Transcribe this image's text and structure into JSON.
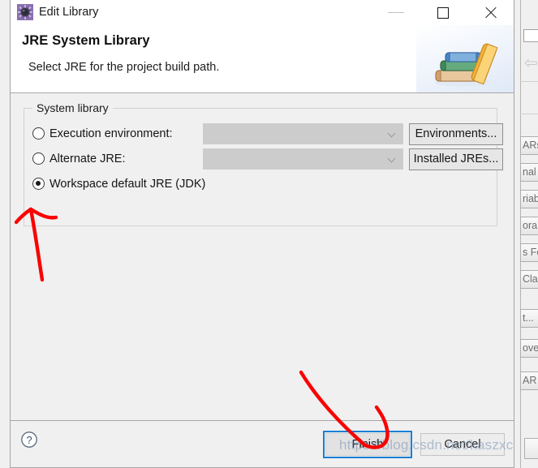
{
  "window": {
    "title": "Edit Library",
    "icon": "library-gear-icon",
    "controls": {
      "minimize": "minimize-icon",
      "maximize": "maximize-icon",
      "close": "close-icon"
    }
  },
  "header": {
    "title": "JRE System Library",
    "subtitle": "Select JRE for the project build path.",
    "banner_icon": "books-stack-icon"
  },
  "main": {
    "group": {
      "legend": "System library",
      "options": [
        {
          "label": "Execution environment:",
          "selected": false,
          "combo_value": "",
          "combo_enabled": false,
          "button": "Environments..."
        },
        {
          "label": "Alternate JRE:",
          "selected": false,
          "combo_value": "",
          "combo_enabled": false,
          "button": "Installed JREs..."
        },
        {
          "label": "Workspace default JRE (JDK)",
          "selected": true
        }
      ]
    }
  },
  "footer": {
    "help_icon": "help-question-icon",
    "finish_label": "Finish",
    "cancel_label": "Cancel",
    "finish_focused": true
  },
  "watermark": {
    "text": "https://blog.csdn.net/kaszxc"
  },
  "annotations": {
    "arrow_to_radio": "red-arrow-up",
    "arrow_to_finish": "red-arrow-curved"
  },
  "background": {
    "right_buttons": [
      "ARs...",
      "nal J",
      "riabl",
      "orary",
      "s Fol",
      "Class",
      "t...",
      "ove",
      "AR"
    ],
    "back_arrow_icon": "arrow-left-icon"
  },
  "colors": {
    "accent_focus": "#1a7fd4",
    "annotation": "#fa0000",
    "dialog_bg": "#f0f0f0",
    "header_bg": "#ffffff",
    "combo_disabled": "#cccccc"
  }
}
